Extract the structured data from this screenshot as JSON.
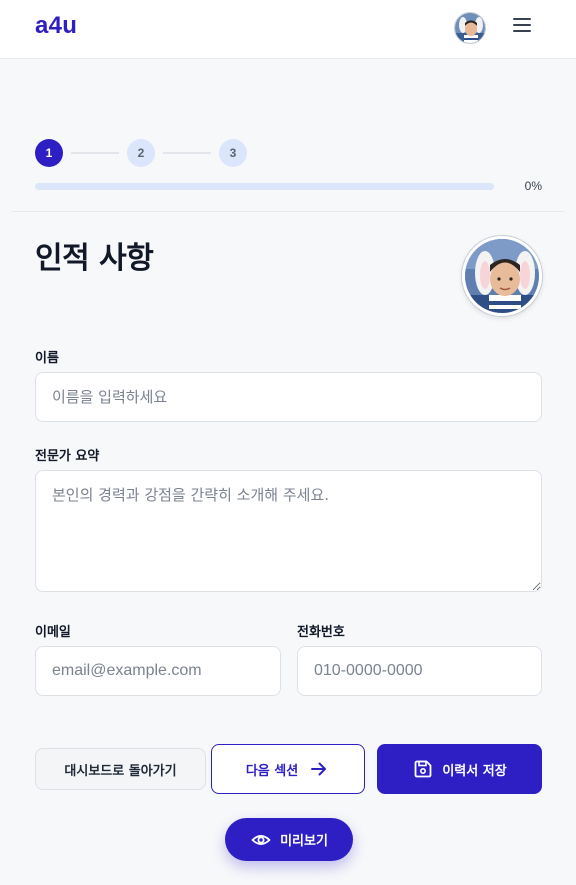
{
  "app": {
    "brand": "a4u"
  },
  "header": {
    "avatar_icon": "user-avatar",
    "menu_icon": "hamburger-menu-icon"
  },
  "stepper": {
    "steps": [
      {
        "label": "1",
        "state": "active"
      },
      {
        "label": "2",
        "state": "upcoming"
      },
      {
        "label": "3",
        "state": "upcoming"
      }
    ]
  },
  "progress": {
    "value": 0,
    "text": "0%"
  },
  "section": {
    "title": "인적 사항",
    "photo_icon": "profile-photo"
  },
  "form": {
    "name": {
      "label": "이름",
      "placeholder": "이름을 입력하세요",
      "value": ""
    },
    "summary": {
      "label": "전문가 요약",
      "placeholder": "본인의 경력과 강점을 간략히 소개해 주세요.",
      "value": ""
    },
    "email": {
      "label": "이메일",
      "placeholder": "email@example.com",
      "value": ""
    },
    "phone": {
      "label": "전화번호",
      "placeholder": "010-0000-0000",
      "value": ""
    }
  },
  "actions": {
    "back_label": "대시보드로 돌아가기",
    "next_label": "다음 섹션",
    "next_icon": "arrow-right-icon",
    "save_label": "이력서 저장",
    "save_icon": "floppy-disk-icon",
    "preview_label": "미리보기",
    "preview_icon": "eye-icon"
  },
  "colors": {
    "accent": "#2d1fc4",
    "progress_track": "#dbe6fb",
    "step_inactive": "#dbe5fb",
    "page_bg": "#f7f8fa"
  }
}
